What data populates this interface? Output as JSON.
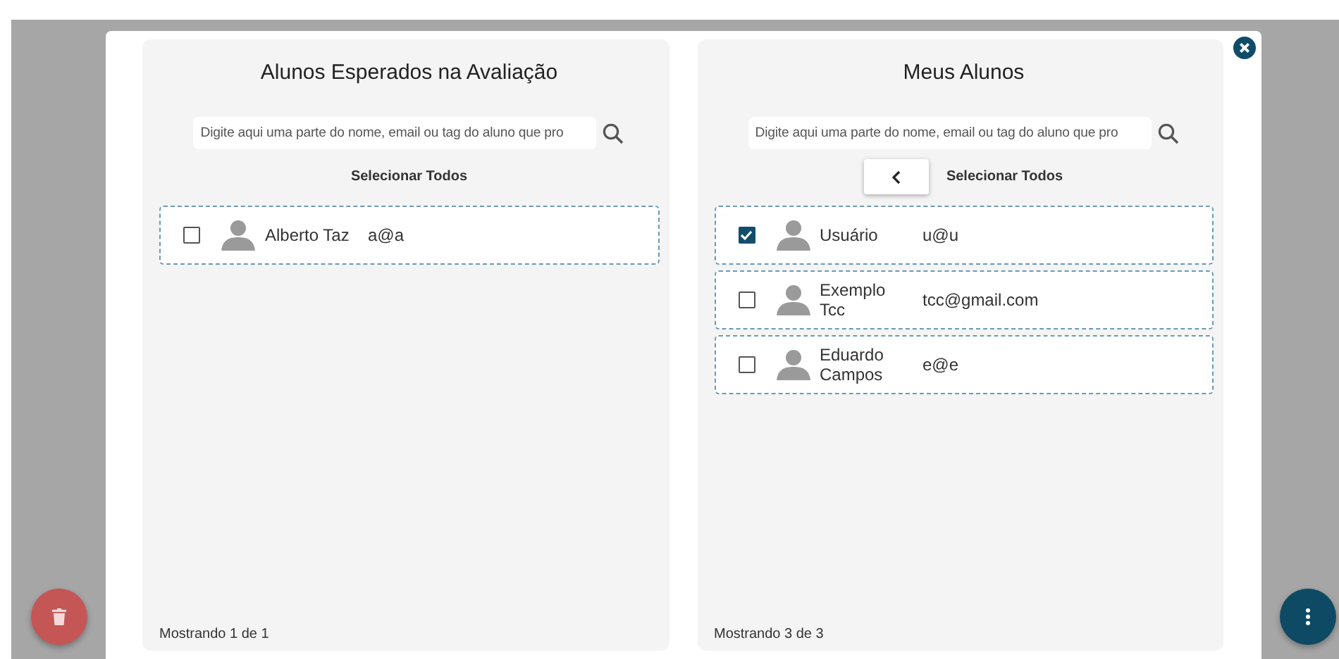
{
  "panels": [
    {
      "title": "Alunos Esperados na Avaliação",
      "search": {
        "placeholder": "Digite aqui uma parte do nome, email ou tag do aluno que pro"
      },
      "back_button": false,
      "select_all": "Selecionar Todos",
      "students": [
        {
          "name": "Alberto Taz",
          "email": "a@a",
          "checked": false
        }
      ],
      "footer": "Mostrando 1 de 1"
    },
    {
      "title": "Meus Alunos",
      "search": {
        "placeholder": "Digite aqui uma parte do nome, email ou tag do aluno que pro"
      },
      "back_button": true,
      "select_all": "Selecionar Todos",
      "students": [
        {
          "name": "Usuário",
          "email": "u@u",
          "checked": true
        },
        {
          "name": "Exemplo Tcc",
          "email": "tcc@gmail.com",
          "checked": false
        },
        {
          "name": "Eduardo Campos",
          "email": "e@e",
          "checked": false
        }
      ],
      "footer": "Mostrando 3 de 3"
    }
  ]
}
